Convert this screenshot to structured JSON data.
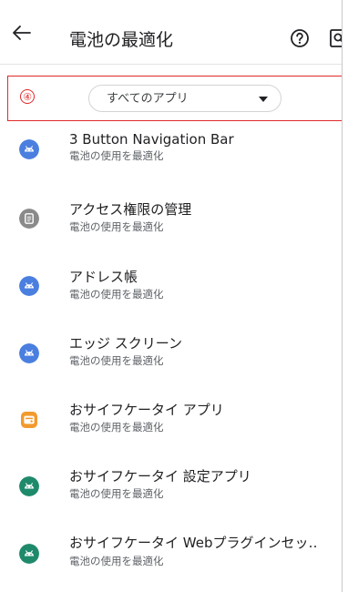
{
  "header": {
    "title": "電池の最適化"
  },
  "filter": {
    "step_number": "④",
    "dropdown_value": "すべてのアプリ"
  },
  "apps": [
    {
      "name": "3 Button Navigation Bar",
      "status": "電池の使用を最適化",
      "icon": "android-robot-icon",
      "icon_color": "#4a7fe0"
    },
    {
      "name": "アクセス権限の管理",
      "status": "電池の使用を最適化",
      "icon": "permission-manager-icon",
      "icon_color": "#8a8a8a"
    },
    {
      "name": "アドレス帳",
      "status": "電池の使用を最適化",
      "icon": "android-robot-icon",
      "icon_color": "#4a7fe0"
    },
    {
      "name": "エッジ スクリーン",
      "status": "電池の使用を最適化",
      "icon": "android-robot-icon",
      "icon_color": "#4a7fe0"
    },
    {
      "name": "おサイフケータイ アプリ",
      "status": "電池の使用を最適化",
      "icon": "osaifu-keitai-app-icon",
      "icon_color": "#f29a2e"
    },
    {
      "name": "おサイフケータイ 設定アプリ",
      "status": "電池の使用を最適化",
      "icon": "android-robot-icon",
      "icon_color": "#1f8a6b"
    },
    {
      "name": "おサイフケータイ Webプラグインセッ‥",
      "status": "電池の使用を最適化",
      "icon": "android-robot-icon",
      "icon_color": "#1f8a6b"
    }
  ],
  "colors": {
    "highlight_border": "#e0292b",
    "android_blue": "#4a7fe0",
    "android_green": "#1f8a6b",
    "permission_gray": "#8a8a8a",
    "osaifu_orange": "#f29a2e"
  }
}
